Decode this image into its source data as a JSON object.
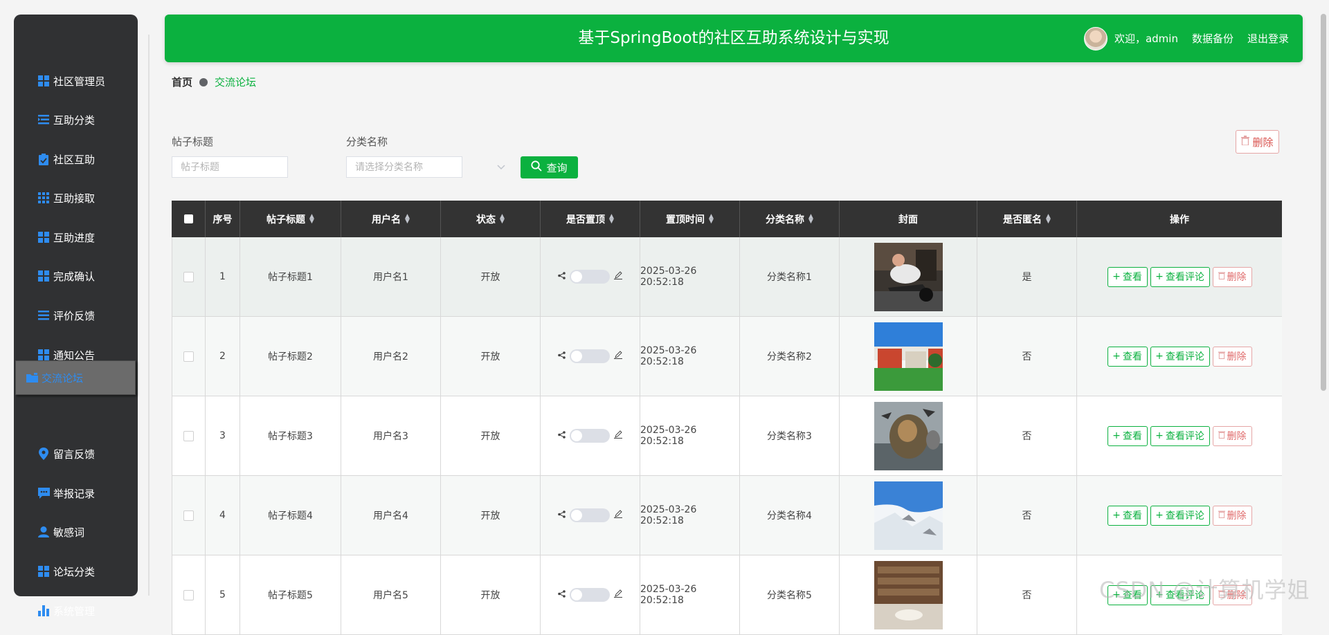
{
  "sidebar": {
    "items": [
      {
        "label": "社区管理员",
        "icon": "grid-icon"
      },
      {
        "label": "互助分类",
        "icon": "list-indent-icon"
      },
      {
        "label": "社区互助",
        "icon": "clipboard-icon"
      },
      {
        "label": "互助接取",
        "icon": "apps-icon"
      },
      {
        "label": "互助进度",
        "icon": "grid-icon"
      },
      {
        "label": "完成确认",
        "icon": "grid-icon"
      },
      {
        "label": "评价反馈",
        "icon": "list-icon"
      },
      {
        "label": "通知公告",
        "icon": "grid-icon"
      },
      {
        "label": "交流论坛",
        "icon": "folder-icon"
      },
      {
        "label": "留言反馈",
        "icon": "location-icon"
      },
      {
        "label": "举报记录",
        "icon": "chat-icon"
      },
      {
        "label": "敏感词",
        "icon": "user-icon"
      },
      {
        "label": "论坛分类",
        "icon": "grid-icon"
      },
      {
        "label": "系统管理",
        "icon": "bar-chart-icon"
      }
    ],
    "active_index": 8
  },
  "header": {
    "title": "基于SpringBoot的社区互助系统设计与实现",
    "welcome": "欢迎，admin",
    "backup": "数据备份",
    "logout": "退出登录"
  },
  "breadcrumb": {
    "home": "首页",
    "current": "交流论坛"
  },
  "search": {
    "title_label": "帖子标题",
    "title_placeholder": "帖子标题",
    "category_label": "分类名称",
    "category_placeholder": "请选择分类名称",
    "query_button": "查询",
    "delete_button": "删除"
  },
  "table": {
    "headers": [
      "序号",
      "帖子标题",
      "用户名",
      "状态",
      "是否置顶",
      "置顶时间",
      "分类名称",
      "封面",
      "是否匿名",
      "操作"
    ],
    "rows": [
      {
        "no": "1",
        "title": "帖子标题1",
        "user": "用户名1",
        "status": "开放",
        "time": "2025-03-26 20:52:18",
        "category": "分类名称1",
        "anon": "是",
        "cover": "gym-photo"
      },
      {
        "no": "2",
        "title": "帖子标题2",
        "user": "用户名2",
        "status": "开放",
        "time": "2025-03-26 20:52:18",
        "category": "分类名称2",
        "anon": "否",
        "cover": "campus-photo"
      },
      {
        "no": "3",
        "title": "帖子标题3",
        "user": "用户名3",
        "status": "开放",
        "time": "2025-03-26 20:52:18",
        "category": "分类名称3",
        "anon": "否",
        "cover": "lion-fantasy-photo"
      },
      {
        "no": "4",
        "title": "帖子标题4",
        "user": "用户名4",
        "status": "开放",
        "time": "2025-03-26 20:52:18",
        "category": "分类名称4",
        "anon": "否",
        "cover": "snow-mountain-photo"
      },
      {
        "no": "5",
        "title": "帖子标题5",
        "user": "用户名5",
        "status": "开放",
        "time": "2025-03-26 20:52:18",
        "category": "分类名称5",
        "anon": "否",
        "cover": "library-photo"
      }
    ],
    "actions": {
      "view": "查看",
      "view_comments": "查看评论",
      "delete": "删除"
    }
  },
  "watermark": "CSDN @计算机学姐",
  "colors": {
    "primary": "#0bb13f",
    "sidebar": "#303133",
    "active_text": "#2e8cf0",
    "danger": "#e06c6c"
  }
}
